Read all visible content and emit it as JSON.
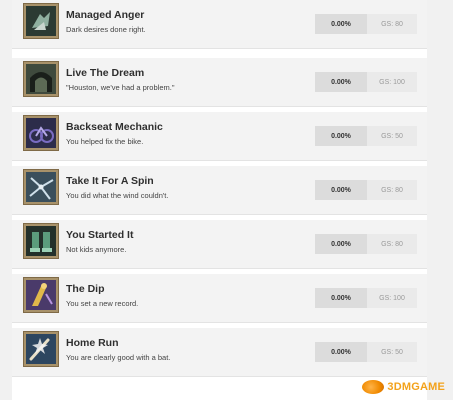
{
  "achievements": [
    {
      "icon": "broken-vase-icon",
      "title": "Managed Anger",
      "description": "Dark desires done right.",
      "percent": "0.00%",
      "gamerscore": "GS: 80"
    },
    {
      "icon": "tunnel-icon",
      "title": "Live The Dream",
      "description": "\"Houston, we've had a problem.\"",
      "percent": "0.00%",
      "gamerscore": "GS: 100"
    },
    {
      "icon": "bike-icon",
      "title": "Backseat Mechanic",
      "description": "You helped fix the bike.",
      "percent": "0.00%",
      "gamerscore": "GS: 50"
    },
    {
      "icon": "windmill-icon",
      "title": "Take It For A Spin",
      "description": "You did what the wind couldn't.",
      "percent": "0.00%",
      "gamerscore": "GS: 80"
    },
    {
      "icon": "boots-icon",
      "title": "You Started It",
      "description": "Not kids anymore.",
      "percent": "0.00%",
      "gamerscore": "GS: 80"
    },
    {
      "icon": "diver-icon",
      "title": "The Dip",
      "description": "You set a new record.",
      "percent": "0.00%",
      "gamerscore": "GS: 100"
    },
    {
      "icon": "bat-icon",
      "title": "Home Run",
      "description": "You are clearly good with a bat.",
      "percent": "0.00%",
      "gamerscore": "GS: 50"
    }
  ],
  "watermark": {
    "text": "3DMGAME"
  },
  "colors": {
    "icon_frame": "#a8926a",
    "row_bg": "#f3f3f3",
    "percent_bg": "#dcdcdc",
    "watermark": "#f3a21b"
  }
}
